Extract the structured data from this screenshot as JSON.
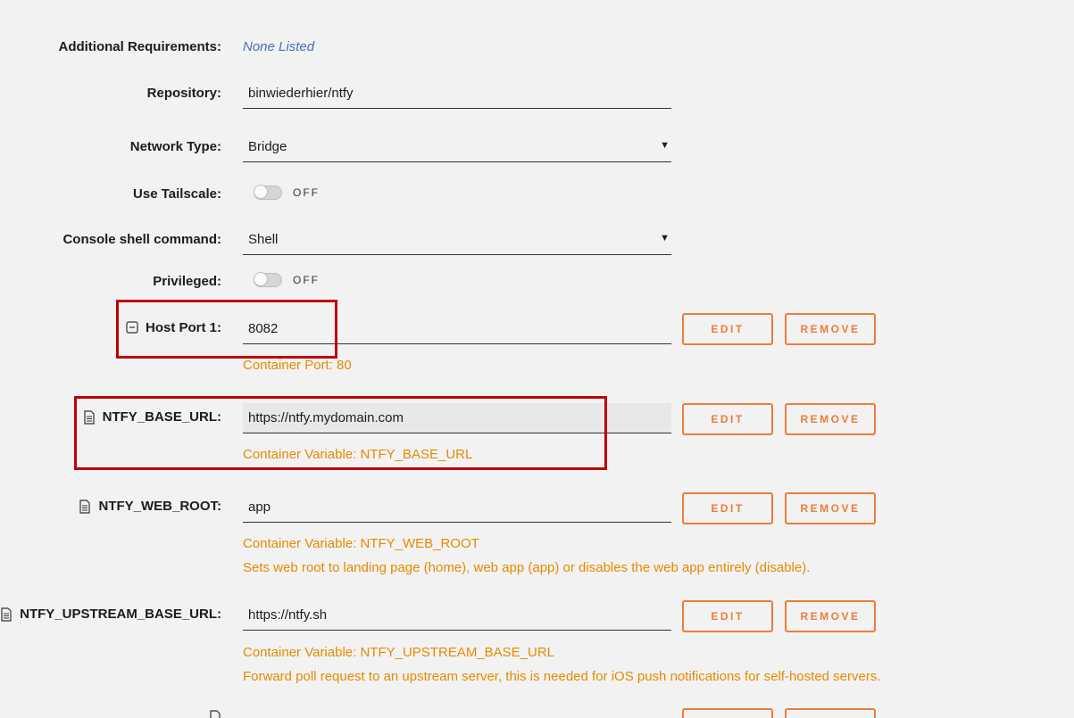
{
  "rows": {
    "additional_requirements": {
      "label": "Additional Requirements:",
      "value": "None Listed"
    },
    "repository": {
      "label": "Repository:",
      "value": "binwiederhier/ntfy"
    },
    "network_type": {
      "label": "Network Type:",
      "value": "Bridge"
    },
    "use_tailscale": {
      "label": "Use Tailscale:",
      "state": "OFF"
    },
    "console_shell": {
      "label": "Console shell command:",
      "value": "Shell"
    },
    "privileged": {
      "label": "Privileged:",
      "state": "OFF"
    },
    "host_port": {
      "label": "Host Port 1:",
      "value": "8082",
      "help": "Container Port: 80"
    },
    "ntfy_base_url": {
      "label": "NTFY_BASE_URL:",
      "value": "https://ntfy.mydomain.com",
      "help": "Container Variable: NTFY_BASE_URL"
    },
    "ntfy_web_root": {
      "label": "NTFY_WEB_ROOT:",
      "value": "app",
      "help": "Container Variable: NTFY_WEB_ROOT",
      "description": "Sets web root to landing page (home), web app (app) or disables the web app entirely (disable)."
    },
    "ntfy_upstream": {
      "label": "NTFY_UPSTREAM_BASE_URL:",
      "value": "https://ntfy.sh",
      "help": "Container Variable: NTFY_UPSTREAM_BASE_URL",
      "description": "Forward poll request to an upstream server, this is needed for iOS push notifications for self-hosted servers."
    }
  },
  "buttons": {
    "edit": "EDIT",
    "remove": "REMOVE"
  },
  "colors": {
    "accent": "#ef7b38",
    "help_text": "#e68a00",
    "link": "#486dba",
    "highlight": "#c00000",
    "background": "#f2f2f2"
  },
  "icons": {
    "port": "minus-square-icon",
    "variable": "document-icon"
  }
}
